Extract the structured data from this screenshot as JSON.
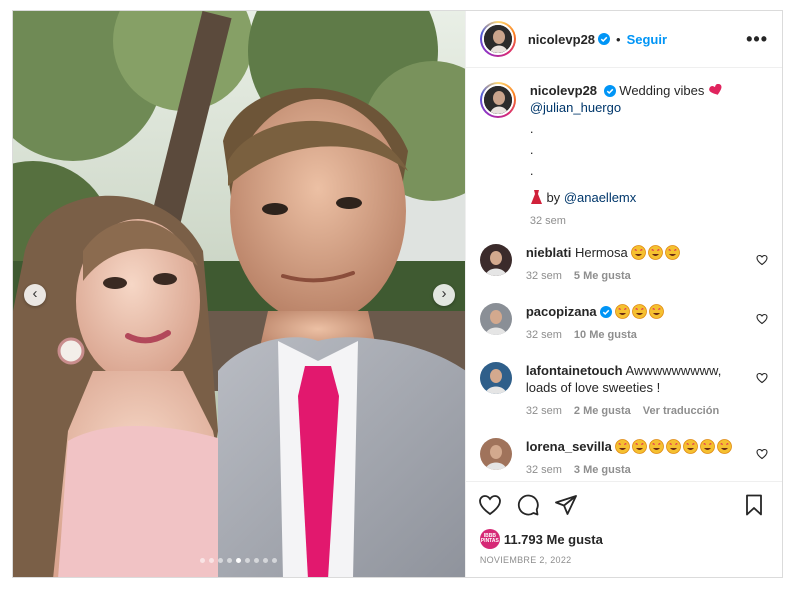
{
  "post": {
    "username": "nicolevp28",
    "separator": "•",
    "follow_label": "Seguir",
    "more_label": "•••"
  },
  "media": {
    "prev_arrow": "‹",
    "next_arrow": "›",
    "carousel_count": 9,
    "active_index": 4
  },
  "caption": {
    "username": "nicolevp28",
    "text": "Wedding vibes",
    "mention": "@julian_huergo",
    "dots": [
      ".",
      ".",
      "."
    ],
    "credit_prefix": "by",
    "credit_mention": "@anaellemx",
    "time": "32 sem"
  },
  "comments": [
    {
      "username": "nieblati",
      "verified": false,
      "text": "Hermosa",
      "emoji_count": 3,
      "time": "32 sem",
      "likes": "5 Me gusta",
      "extra": ""
    },
    {
      "username": "pacopizana",
      "verified": true,
      "text": "",
      "emoji_count": 3,
      "time": "32 sem",
      "likes": "10 Me gusta",
      "extra": ""
    },
    {
      "username": "lafontainetouch",
      "verified": false,
      "text": "Awwwwwwwww, loads of love sweeties !",
      "emoji_count": 0,
      "time": "32 sem",
      "likes": "2 Me gusta",
      "extra": "Ver traducción"
    },
    {
      "username": "lorena_sevilla",
      "verified": false,
      "text": "",
      "emoji_count": 7,
      "time": "32 sem",
      "likes": "3 Me gusta",
      "extra": ""
    }
  ],
  "actions": {
    "like_icon": "heart-icon",
    "comment_icon": "comment-icon",
    "share_icon": "paper-plane-icon",
    "save_icon": "bookmark-icon"
  },
  "likes": {
    "badge_text": "IBBB PINTAS",
    "count": "11.793 Me gusta"
  },
  "date": "NOVIEMBRE 2, 2022",
  "colors": {
    "accent": "#0095f6",
    "muted": "#8e8e8e",
    "border": "#dbdbdb",
    "text": "#262626"
  }
}
